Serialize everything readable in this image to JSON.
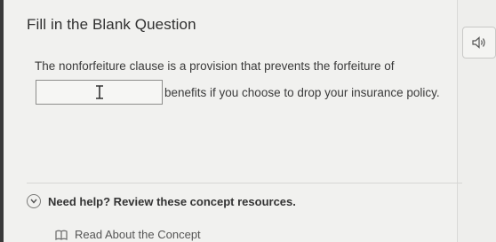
{
  "question": {
    "title": "Fill in the Blank Question",
    "prompt": "The nonforfeiture clause is a provision that prevents the forfeiture of",
    "after_blank": "benefits if you choose to drop your insurance policy.",
    "blank_value": ""
  },
  "help": {
    "label": "Need help? Review these concept resources.",
    "resource_link": "Read About the Concept"
  },
  "icons": {
    "audio": "speaker-icon",
    "text_cursor": "text-cursor-icon",
    "expand": "chevron-down-icon",
    "book": "book-icon"
  }
}
